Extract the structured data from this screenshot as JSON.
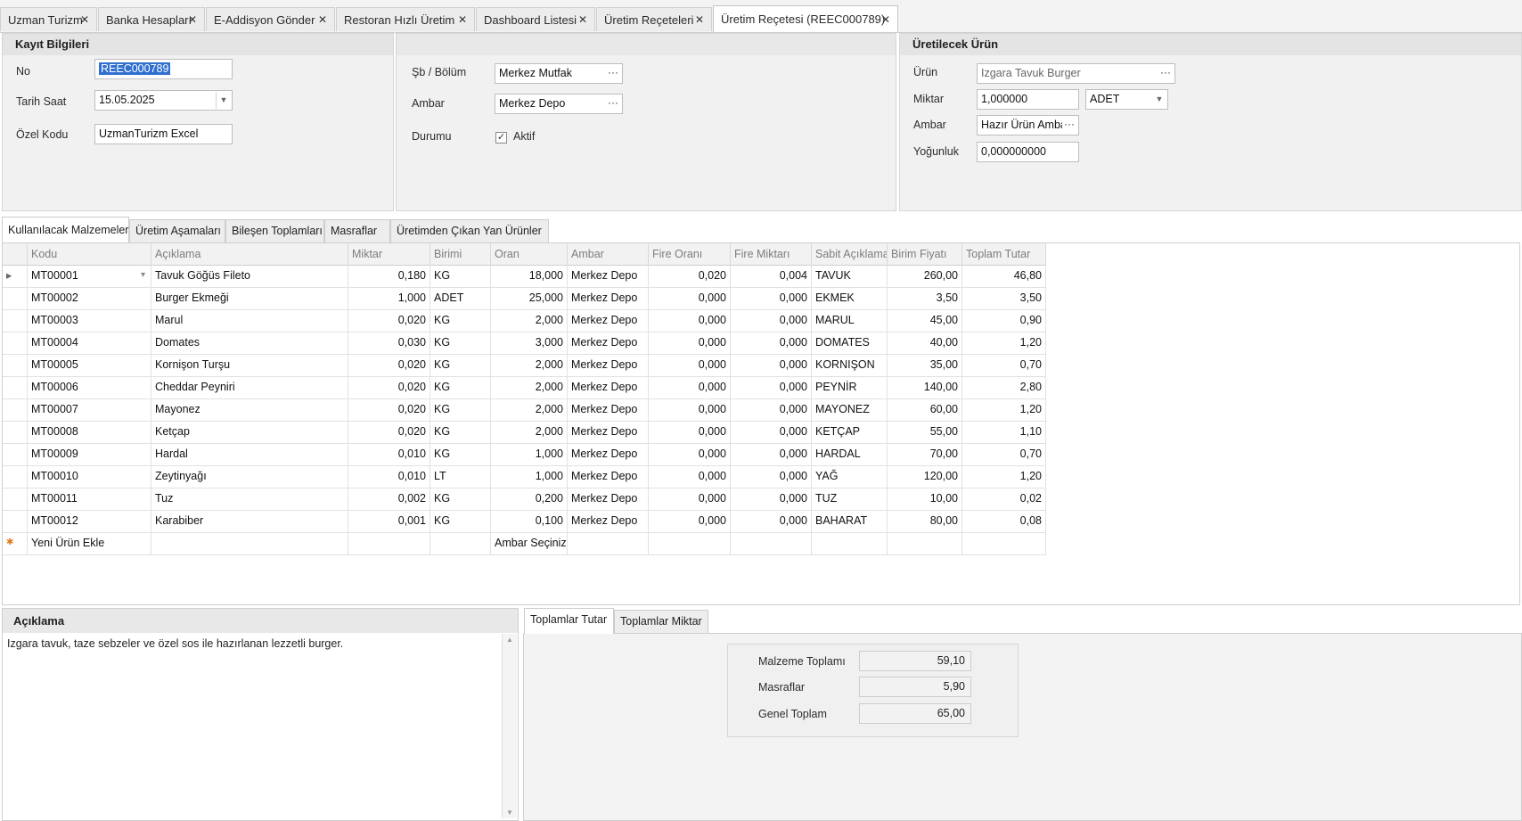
{
  "tabs": [
    {
      "label": "Uzman Turizm"
    },
    {
      "label": "Banka Hesapları"
    },
    {
      "label": "E-Addisyon Gönder"
    },
    {
      "label": "Restoran Hızlı Üretim"
    },
    {
      "label": "Dashboard Listesi"
    },
    {
      "label": "Üretim Reçeteleri"
    },
    {
      "label": "Üretim Reçetesi (REEC000789)"
    }
  ],
  "close_glyph": "✕",
  "kayit": {
    "title": "Kayıt Bilgileri",
    "no_label": "No",
    "no_value": "REEC000789",
    "tarih_label": "Tarih Saat",
    "tarih_value": "15.05.2025",
    "ozel_label": "Özel Kodu",
    "ozel_value": "UzmanTurizm Excel"
  },
  "middle": {
    "sb_label": "Şb / Bölüm",
    "sb_value": "Merkez Mutfak",
    "ambar_label": "Ambar",
    "ambar_value": "Merkez Depo",
    "durum_label": "Durumu",
    "aktif_label": "Aktif"
  },
  "urun": {
    "title": "Üretilecek Ürün",
    "urun_label": "Ürün",
    "urun_value": "Izgara Tavuk Burger",
    "miktar_label": "Miktar",
    "miktar_value": "1,000000",
    "birim_value": "ADET",
    "ambar_label": "Ambar",
    "ambar_value": "Hazır Ürün Ambar",
    "yogunluk_label": "Yoğunluk",
    "yogunluk_value": "0,000000000"
  },
  "subtabs": [
    {
      "label": "Kullanılacak Malzemeler"
    },
    {
      "label": "Üretim Aşamaları"
    },
    {
      "label": "Bileşen Toplamları"
    },
    {
      "label": "Masraflar"
    },
    {
      "label": "Üretimden Çıkan Yan Ürünler"
    }
  ],
  "grid": {
    "columns": [
      "Kodu",
      "Açıklama",
      "Miktar",
      "Birimi",
      "Oran",
      "Ambar",
      "Fire Oranı",
      "Fire Miktarı",
      "Sabit Açıklama",
      "Birim Fiyatı",
      "Toplam Tutar"
    ],
    "rows": [
      [
        "MT00001",
        "Tavuk Göğüs Fileto",
        "0,180",
        "KG",
        "18,000",
        "Merkez Depo",
        "0,020",
        "0,004",
        "TAVUK",
        "260,00",
        "46,80"
      ],
      [
        "MT00002",
        "Burger Ekmeği",
        "1,000",
        "ADET",
        "25,000",
        "Merkez Depo",
        "0,000",
        "0,000",
        "EKMEK",
        "3,50",
        "3,50"
      ],
      [
        "MT00003",
        "Marul",
        "0,020",
        "KG",
        "2,000",
        "Merkez Depo",
        "0,000",
        "0,000",
        "MARUL",
        "45,00",
        "0,90"
      ],
      [
        "MT00004",
        "Domates",
        "0,030",
        "KG",
        "3,000",
        "Merkez Depo",
        "0,000",
        "0,000",
        "DOMATES",
        "40,00",
        "1,20"
      ],
      [
        "MT00005",
        "Kornişon Turşu",
        "0,020",
        "KG",
        "2,000",
        "Merkez Depo",
        "0,000",
        "0,000",
        "KORNIŞON",
        "35,00",
        "0,70"
      ],
      [
        "MT00006",
        "Cheddar Peyniri",
        "0,020",
        "KG",
        "2,000",
        "Merkez Depo",
        "0,000",
        "0,000",
        "PEYNİR",
        "140,00",
        "2,80"
      ],
      [
        "MT00007",
        "Mayonez",
        "0,020",
        "KG",
        "2,000",
        "Merkez Depo",
        "0,000",
        "0,000",
        "MAYONEZ",
        "60,00",
        "1,20"
      ],
      [
        "MT00008",
        "Ketçap",
        "0,020",
        "KG",
        "2,000",
        "Merkez Depo",
        "0,000",
        "0,000",
        "KETÇAP",
        "55,00",
        "1,10"
      ],
      [
        "MT00009",
        "Hardal",
        "0,010",
        "KG",
        "1,000",
        "Merkez Depo",
        "0,000",
        "0,000",
        "HARDAL",
        "70,00",
        "0,70"
      ],
      [
        "MT00010",
        "Zeytinyağı",
        "0,010",
        "LT",
        "1,000",
        "Merkez Depo",
        "0,000",
        "0,000",
        "YAĞ",
        "120,00",
        "1,20"
      ],
      [
        "MT00011",
        "Tuz",
        "0,002",
        "KG",
        "0,200",
        "Merkez Depo",
        "0,000",
        "0,000",
        "TUZ",
        "10,00",
        "0,02"
      ],
      [
        "MT00012",
        "Karabiber",
        "0,001",
        "KG",
        "0,100",
        "Merkez Depo",
        "0,000",
        "0,000",
        "BAHARAT",
        "80,00",
        "0,08"
      ]
    ],
    "new_row_label": "Yeni Ürün Ekle",
    "new_row_ambar": "Ambar Seçiniz"
  },
  "aciklama": {
    "title": "Açıklama",
    "text": "Izgara tavuk, taze sebzeler ve özel sos ile hazırlanan lezzetli burger."
  },
  "bottom_tabs": [
    {
      "label": "Toplamlar Tutar"
    },
    {
      "label": "Toplamlar Miktar"
    }
  ],
  "totals": [
    {
      "label": "Malzeme Toplamı",
      "value": "59,10"
    },
    {
      "label": "Masraflar",
      "value": "5,90"
    },
    {
      "label": "Genel Toplam",
      "value": "65,00"
    }
  ]
}
